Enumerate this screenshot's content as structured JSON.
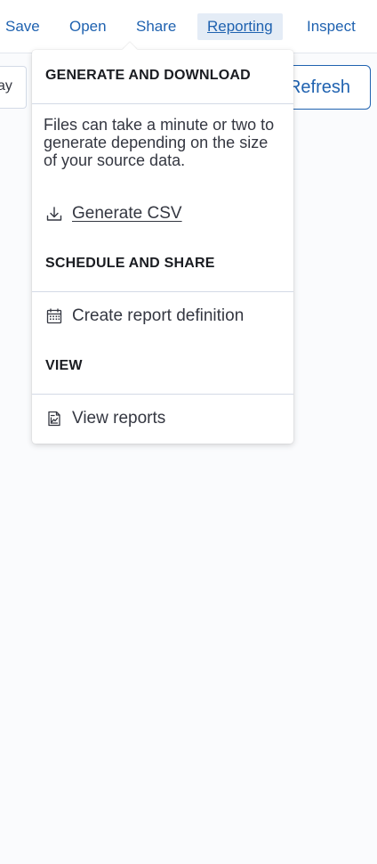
{
  "nav": {
    "links": [
      {
        "label": "Save"
      },
      {
        "label": "Open"
      },
      {
        "label": "Share"
      },
      {
        "label": "Reporting"
      },
      {
        "label": "Inspect"
      }
    ]
  },
  "toolbar": {
    "left_field_text": "ay",
    "refresh_label": "Refresh"
  },
  "reporting_menu": {
    "generate": {
      "title": "GENERATE AND DOWNLOAD",
      "description": "Files can take a minute or two to generate depending on the size of your source data.",
      "action_label": "Generate CSV",
      "icon": "download-icon"
    },
    "schedule": {
      "title": "SCHEDULE AND SHARE",
      "action_label": "Create report definition",
      "icon": "calendar-icon"
    },
    "view": {
      "title": "VIEW",
      "action_label": "View reports",
      "icon": "report-icon"
    }
  },
  "colors": {
    "link": "#1f62b0",
    "active_tab_bg": "#e4ecf6",
    "page_bg": "#fafbfd",
    "divider": "#d3dae6"
  }
}
